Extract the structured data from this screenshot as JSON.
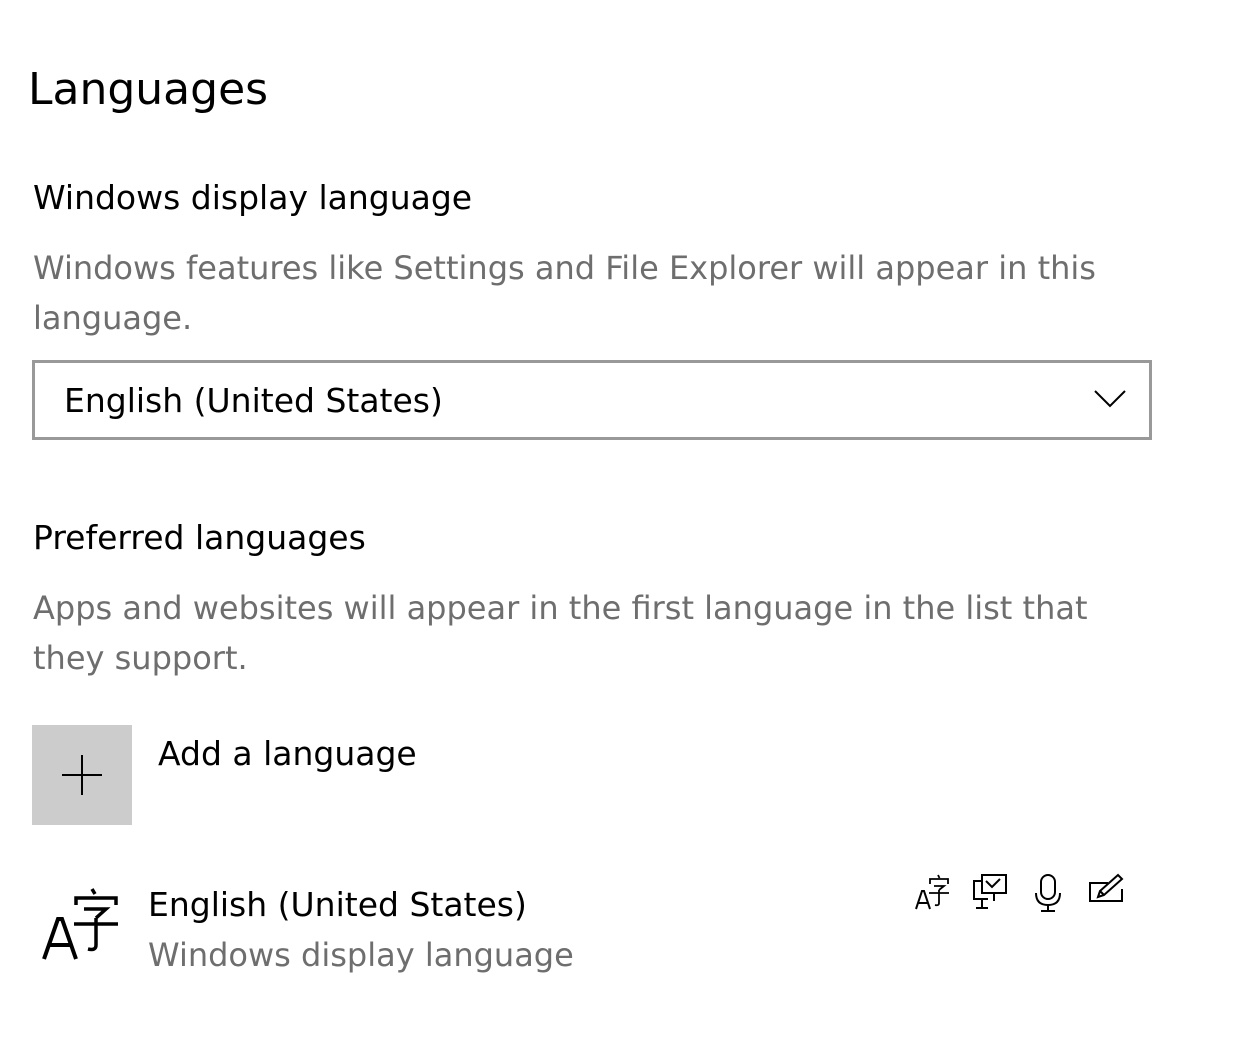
{
  "page": {
    "title": "Languages"
  },
  "display_language": {
    "title": "Windows display language",
    "description": "Windows features like Settings and File Explorer will appear in this language.",
    "selected": "English (United States)"
  },
  "preferred_languages": {
    "title": "Preferred languages",
    "description": "Apps and websites will appear in the first language in the list that they support.",
    "add_label": "Add a language",
    "items": [
      {
        "name": "English (United States)",
        "subtitle": "Windows display language",
        "icon": "language-icon",
        "feature_icons": [
          "language-pack-icon",
          "text-to-speech-icon",
          "speech-recognition-icon",
          "handwriting-icon"
        ]
      }
    ]
  },
  "colors": {
    "text": "#000000",
    "secondary_text": "#6e6e6e",
    "dropdown_border": "#999999",
    "add_tile_bg": "#cccccc",
    "background": "#ffffff"
  }
}
